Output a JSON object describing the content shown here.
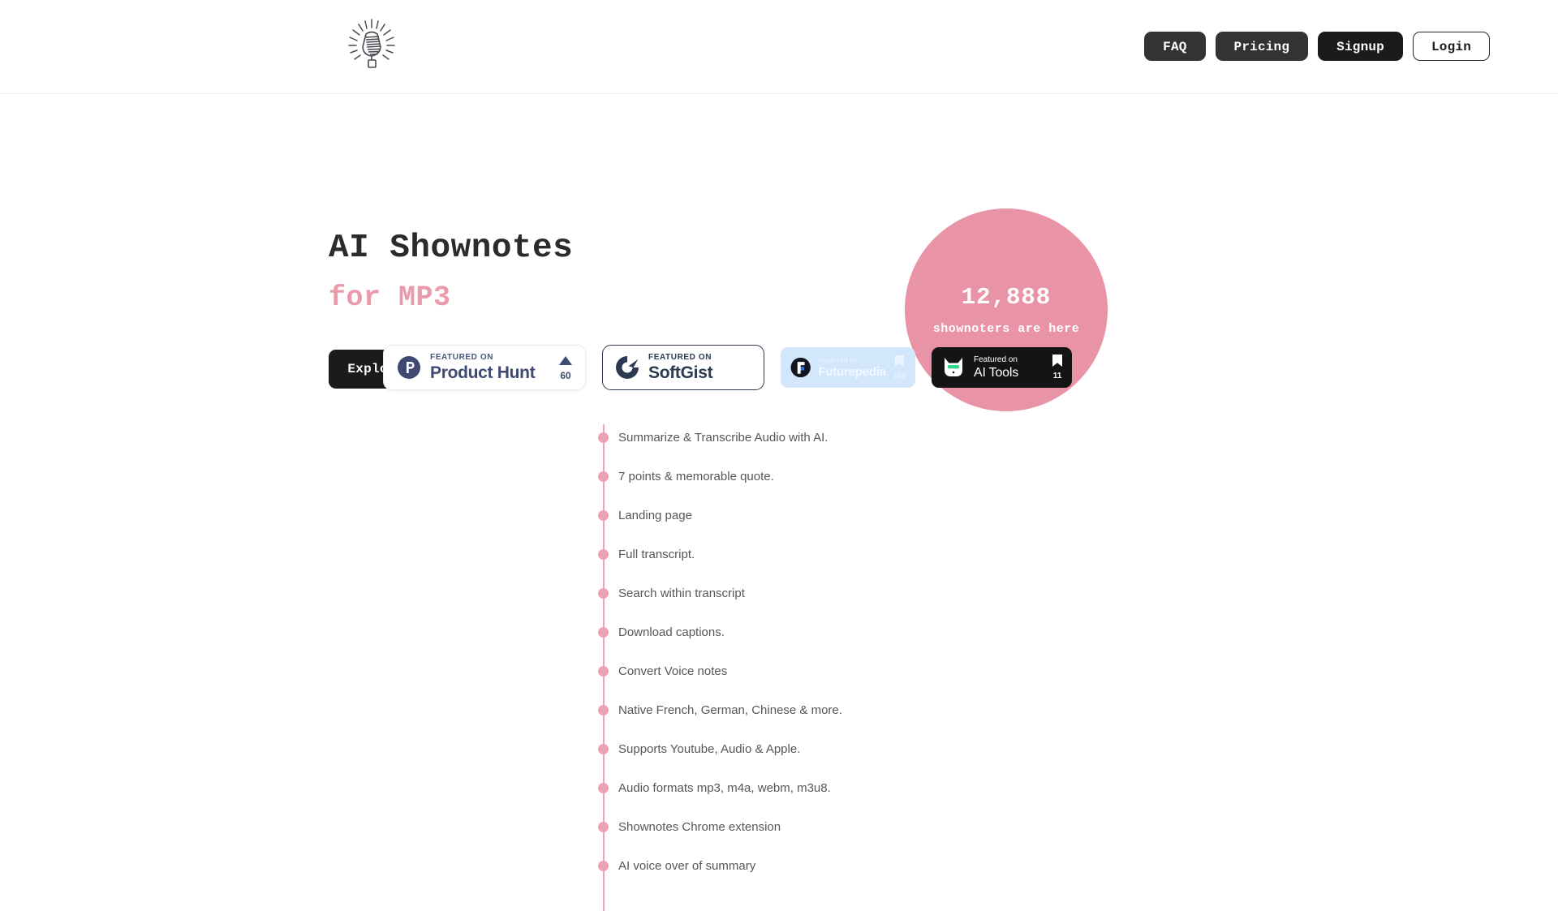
{
  "header": {
    "logo_icon": "microphone-icon",
    "nav": [
      {
        "label": "FAQ",
        "style": "dark"
      },
      {
        "label": "Pricing",
        "style": "dark"
      },
      {
        "label": "Signup",
        "style": "black"
      },
      {
        "label": "Login",
        "style": "ghost"
      }
    ]
  },
  "hero": {
    "title": "AI Shownotes",
    "subtitle": "for MP3",
    "cta_label": "Explore",
    "stat": {
      "number": "12,888",
      "label": "shownoters are here",
      "color": "#e894a6"
    }
  },
  "badges": [
    {
      "id": "product-hunt",
      "eyebrow": "FEATURED ON",
      "name": "Product Hunt",
      "count": "60",
      "metric_icon": "upvote-triangle-icon",
      "logo_icon": "product-hunt-p-icon",
      "accent": "#3e4a72"
    },
    {
      "id": "softgist",
      "eyebrow": "FEATURED ON",
      "name": "SoftGist",
      "count": "",
      "metric_icon": "",
      "logo_icon": "softgist-g-icon",
      "accent": "#2b3a51"
    },
    {
      "id": "futurepedia",
      "eyebrow": "Featured on",
      "name": "Futurepedia",
      "count": "158",
      "metric_icon": "bookmark-icon",
      "logo_icon": "futurepedia-f-icon",
      "accent": "#d2e7fc"
    },
    {
      "id": "ai-tools",
      "eyebrow": "Featured on",
      "name": "AI Tools",
      "count": "11",
      "metric_icon": "bookmark-icon",
      "logo_icon": "ai-tools-robot-icon",
      "accent": "#141414"
    }
  ],
  "features": [
    "Summarize & Transcribe Audio with AI.",
    "7 points & memorable quote.",
    "Landing page",
    "Full transcript.",
    "Search within transcript",
    "Download captions.",
    "Convert Voice notes",
    "Native French, German, Chinese & more.",
    "Supports Youtube, Audio & Apple.",
    "Audio formats mp3, m4a, webm, m3u8.",
    "Shownotes Chrome extension",
    "AI voice over of summary"
  ]
}
